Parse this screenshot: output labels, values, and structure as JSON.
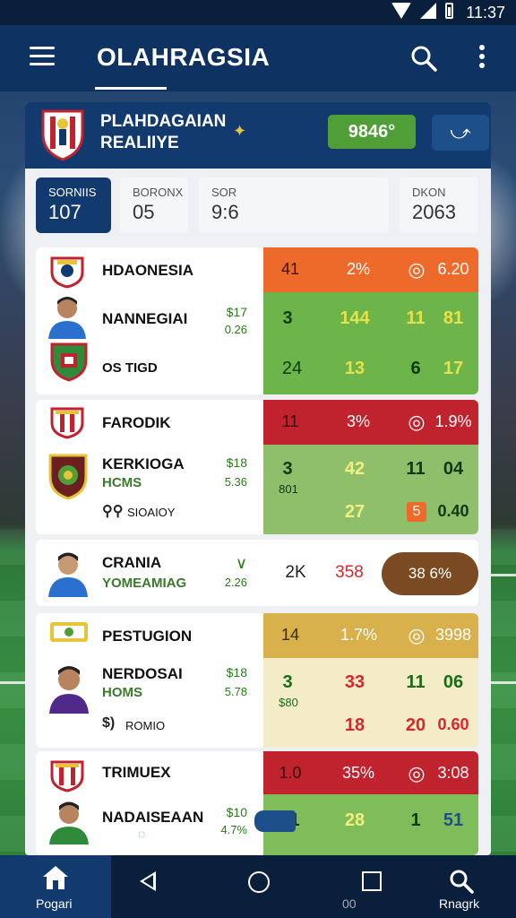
{
  "status": {
    "time": "11:37"
  },
  "appbar": {
    "title": "OLAHRAGSIA"
  },
  "panel": {
    "title_line1": "PLAHDAGAIAN",
    "title_line2": "REALIIYE",
    "score": "9846°",
    "trend_icon": "trend-arrow-icon"
  },
  "stats": [
    {
      "label": "SORNIIS",
      "value": "107"
    },
    {
      "label": "BORONX",
      "value": "05"
    },
    {
      "label": "SOR",
      "value": "9:6"
    },
    {
      "label": "DKON",
      "value": "2063"
    }
  ],
  "colors": {
    "accent": "#123a6e",
    "green": "#4f9e38",
    "orange": "#ee6a2a",
    "red": "#c0222e",
    "tan": "#d8b04c"
  },
  "cards": [
    {
      "rows": [
        {
          "name": "HDAONESIA",
          "c1": "41",
          "c2": "2%",
          "c3": "◎",
          "c4": "6.20"
        },
        {
          "name": "NANNEGIAI",
          "odds_a": "$17",
          "odds_b": "0.26",
          "c1": "3",
          "c2": "144",
          "c3": "11",
          "c4": "81"
        },
        {
          "name": "OS TIGD",
          "c1": "24",
          "c2": "13",
          "c3": "6",
          "c4": "17"
        }
      ]
    },
    {
      "rows": [
        {
          "name": "FARODIK",
          "c1": "11",
          "c2": "3%",
          "c3": "◎",
          "c4": "1.9%"
        },
        {
          "name": "KERKIOGA",
          "sub": "HCMS",
          "odds_a": "$18",
          "odds_b": "5.36",
          "c1": "3",
          "c1b": "801",
          "c2": "42",
          "c3": "11",
          "c4": "04"
        },
        {
          "name": "SIOAIOY",
          "c2": "27",
          "c3": "5",
          "c4": "0.40"
        }
      ]
    },
    {
      "rows": [
        {
          "name": "CRANIA",
          "sub": "YOMEAMIAG",
          "odds_a": "2.26",
          "c1": "2K",
          "c2": "358",
          "pill": "38 6%"
        }
      ]
    },
    {
      "rows": [
        {
          "name": "PESTUGION",
          "c1": "14",
          "c2": "1.7%",
          "c3": "◎",
          "c4": "3998"
        },
        {
          "name": "NERDOSAI",
          "sub": "HOMS",
          "odds_a": "$18",
          "odds_b": "5.78",
          "c1": "3",
          "c1b": "$80",
          "c2": "33",
          "c3": "11",
          "c4": "06"
        },
        {
          "name": "ROMIO",
          "c2": "18",
          "c3": "20",
          "c4": "0.60"
        }
      ]
    },
    {
      "rows": [
        {
          "name": "TRIMUEX",
          "c1": "1.0",
          "c2": "35%",
          "c3": "◎",
          "c4": "3:08"
        },
        {
          "name": "NADAISEAAN",
          "odds_a": "$10",
          "odds_b": "4.7%",
          "c1": "1",
          "c2": "28",
          "c3": "1",
          "c4": "51"
        }
      ]
    }
  ],
  "nav": {
    "home_label": "Pogari",
    "recent_label": "00",
    "search_label": "Rnagrk"
  }
}
